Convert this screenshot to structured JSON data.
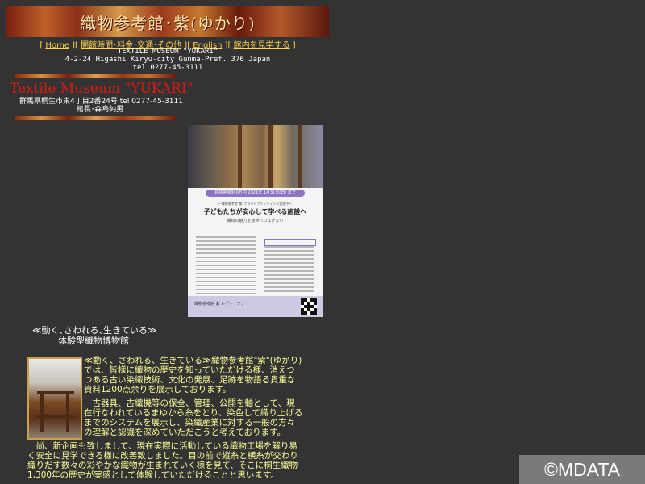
{
  "header": {
    "banner_title": "織物参考館･紫(ゆかり)"
  },
  "nav": {
    "items": [
      {
        "label": "Home"
      },
      {
        "label": "開館時間･料金･交通･その他"
      },
      {
        "label": "English"
      },
      {
        "label": "館内を見学する"
      }
    ]
  },
  "address": {
    "line1": "TEXTILE MUSEUM \"YUKARI\"",
    "line2": "4-2-24 Higashi Kiryu-city Gunma-Pref. 376 Japan",
    "line3": "tel 0277-45-3111"
  },
  "museum": {
    "name": "Textile Museum \"YUKARI\"",
    "jp_address": "群馬県桐生市東4丁目2番24号 tel 0277-45-3111",
    "director": "館長･森島純男"
  },
  "poster": {
    "badge": "目標金額300万円 2021年 1月31日(日) まで",
    "subtitle": "〜織物参考館\"紫\"クラウドファンディング実施中〜",
    "headline": "子どもたちが安心して学べる施設へ",
    "tagline": "織物の魅力を後世へつなぎたい",
    "footer": "織物参考館 紫  レディーフォー"
  },
  "tagline": {
    "line1": "≪動く､さわれる､生きている≫",
    "line2": "体験型織物博物館"
  },
  "body": {
    "para1": "≪動く、さわれる、生きている≫織物参考館\"紫\"(ゆかり)では、皆様に織物の歴史を知っていただける様、消えつつある古い染織技術、文化の発展、足跡を物語る貴重な資料1200点余りを展示しております。",
    "para2": "古器具、古織機等の保全、管理、公開を軸として、現在行なわれているまゆから糸をとり、染色して織り上げるまでのシステムを展示し、染織産業に対する一般の方々の理解と認識を深めていただこうと考えております。",
    "para3": "尚、新企画も致しまして、現在実際に活動している織物工場を解り易く安全に見学できる様に改善致しました。目の前で縦糸と横糸が交わり織りだす数々の彩やかな織物が生まれていく様を見て、そこに桐生織物1,300年の歴史が実感として体験していただけることと思います。"
  },
  "watermark": "©MDATA"
}
